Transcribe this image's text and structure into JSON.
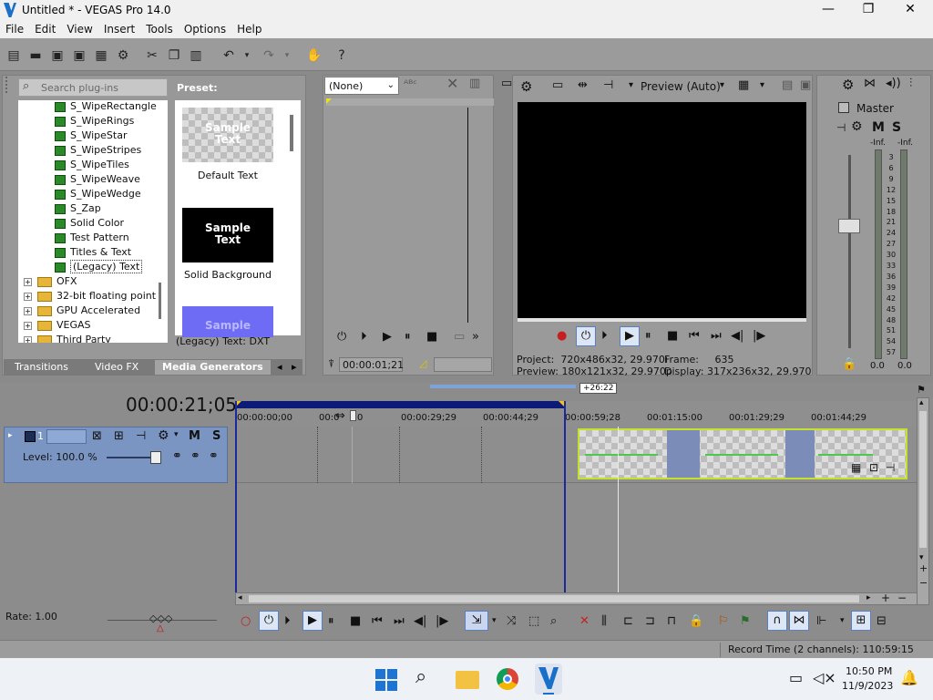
{
  "window": {
    "title": "Untitled * - VEGAS Pro 14.0",
    "minimize": "—",
    "maximize": "❐",
    "close": "✕"
  },
  "menu": [
    "File",
    "Edit",
    "View",
    "Insert",
    "Tools",
    "Options",
    "Help"
  ],
  "explorer": {
    "search_placeholder": "Search plug-ins",
    "items": [
      {
        "label": "S_WipeRectangle",
        "type": "plugin"
      },
      {
        "label": "S_WipeRings",
        "type": "plugin"
      },
      {
        "label": "S_WipeStar",
        "type": "plugin"
      },
      {
        "label": "S_WipeStripes",
        "type": "plugin"
      },
      {
        "label": "S_WipeTiles",
        "type": "plugin"
      },
      {
        "label": "S_WipeWeave",
        "type": "plugin"
      },
      {
        "label": "S_WipeWedge",
        "type": "plugin"
      },
      {
        "label": "S_Zap",
        "type": "plugin"
      },
      {
        "label": "Solid Color",
        "type": "plugin"
      },
      {
        "label": "Test Pattern",
        "type": "plugin"
      },
      {
        "label": "Titles & Text",
        "type": "plugin"
      },
      {
        "label": "(Legacy) Text",
        "type": "plugin",
        "selected": true
      },
      {
        "label": "OFX",
        "type": "folder"
      },
      {
        "label": "32-bit floating point",
        "type": "folder"
      },
      {
        "label": "GPU Accelerated",
        "type": "folder"
      },
      {
        "label": "VEGAS",
        "type": "folder"
      },
      {
        "label": "Third Party",
        "type": "folder"
      }
    ],
    "preset_label": "Preset:",
    "presets": [
      {
        "thumb_text": "Sample\nText",
        "label": "Default Text"
      },
      {
        "thumb_text": "Sample\nText",
        "label": "Solid Background"
      },
      {
        "thumb_text": "Sample",
        "label": ""
      }
    ],
    "selected_caption": "(Legacy) Text: DXT",
    "tabs": [
      "Transitions",
      "Video FX",
      "Media Generators"
    ],
    "active_tab": "Media Generators"
  },
  "trimmer": {
    "dropdown": "(None)",
    "timecode": "00:00:01;21"
  },
  "preview": {
    "quality": "Preview (Auto)",
    "project_label": "Project:",
    "project_value": "720x486x32, 29.970i",
    "frame_label": "Frame:",
    "frame_value": "635",
    "preview_label": "Preview:",
    "preview_value": "180x121x32, 29.970p",
    "display_label": "Display:",
    "display_value": "317x236x32, 29.970"
  },
  "master": {
    "label": "Master",
    "m": "M",
    "s": "S",
    "inf_left": "-Inf.",
    "inf_right": "-Inf.",
    "scale": [
      "3",
      "6",
      "9",
      "12",
      "15",
      "18",
      "21",
      "24",
      "27",
      "30",
      "33",
      "36",
      "39",
      "42",
      "45",
      "48",
      "51",
      "54",
      "57"
    ],
    "val_left": "0.0",
    "val_right": "0.0"
  },
  "timeline": {
    "timecode": "00:00:21;05",
    "region_length": "+26:22",
    "ruler": [
      "00:00:00;00",
      "00:0",
      "0",
      "00:00:29;29",
      "00:00:44;29",
      "00:00:59;28",
      "00:01:15:00",
      "00:01:29;29",
      "00:01:44;29"
    ],
    "track_number": "1",
    "track_m": "M",
    "track_s": "S",
    "level": "Level: 100.0 %",
    "level_value": 1.0
  },
  "transport": {
    "rate": "Rate: 1.00"
  },
  "status": {
    "record_time": "Record Time (2 channels): 110:59:15"
  },
  "taskbar": {
    "time": "10:50 PM",
    "date": "11/9/2023"
  },
  "colors": {
    "track_blue": "#7b95c2",
    "region_navy": "#0c1a78",
    "clip_border": "#c7e02f",
    "accent": "#f6c313"
  }
}
